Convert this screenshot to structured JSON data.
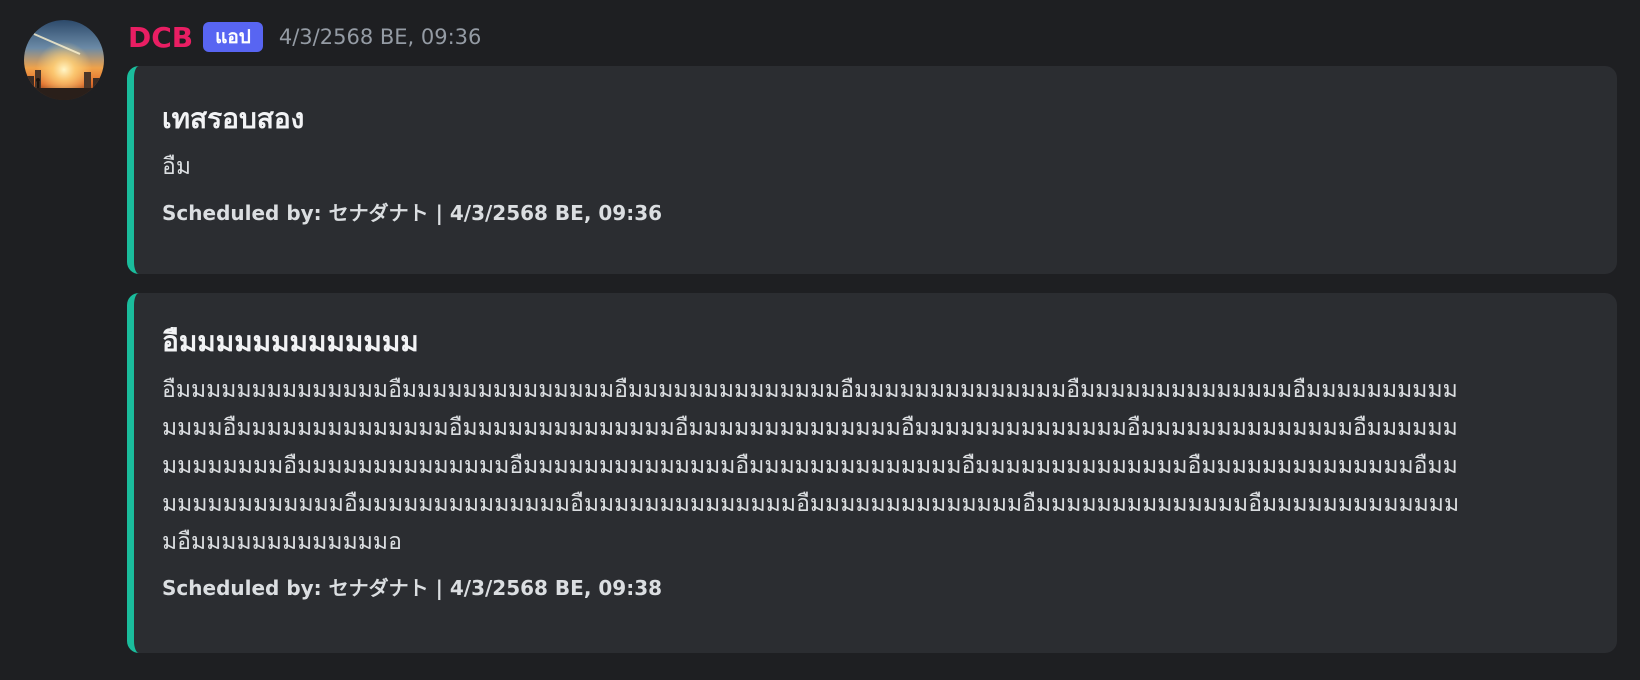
{
  "message": {
    "author": {
      "username": "DCB",
      "badge": "แอป",
      "avatar_icon": "sunset-city-avatar",
      "username_color": "#e91e63"
    },
    "timestamp": "4/3/2568 BE, 09:36",
    "embeds": [
      {
        "title": "เทสรอบสอง",
        "description": "อืม",
        "footer": "Scheduled by: セナダナト | 4/3/2568 BE, 09:36",
        "accent_color": "#1abc9c"
      },
      {
        "title": "อืมมมมมมมมมมมมม",
        "description": "อืมมมมมมมมมมมมมมอืมมมมมมมมมมมมมมอืมมมมมมมมมมมมมมอืมมมมมมมมมมมมมมอืมมมมมมมมมมมมมมอืมมมมมมมมมมมมมมอืมมมมมมมมมมมมมมอืมมมมมมมมมมมมมมอืมมมมมมมมมมมมมมอืมมมมมมมมมมมมมมอืมมมมมมมมมมมมมมอืมมมมมมมมมมมมมมอืมมมมมมมมมมมมมมอืมมมมมมมมมมมมมมอืมมมมมมมมมมมมมมอืมมมมมมมมมมมมมมอืมมมมมมมมมมมมมมอืมมมมมมมมมมมมมมอืมมมมมมมมมมมมมมอืมมมมมมมมมมมมมมอืมมมมมมมมมมมมมมอืมมมมมมมมมมมมมมอืมมมมมมมมมมมมมมอืมมมมมมมมมมมมมอ",
        "footer": "Scheduled by: セナダナト | 4/3/2568 BE, 09:38",
        "accent_color": "#1abc9c"
      }
    ]
  },
  "colors": {
    "background": "#1e1f22",
    "embed_background": "#2b2d31",
    "badge_background": "#5865f2",
    "timestamp": "#949ba4"
  }
}
